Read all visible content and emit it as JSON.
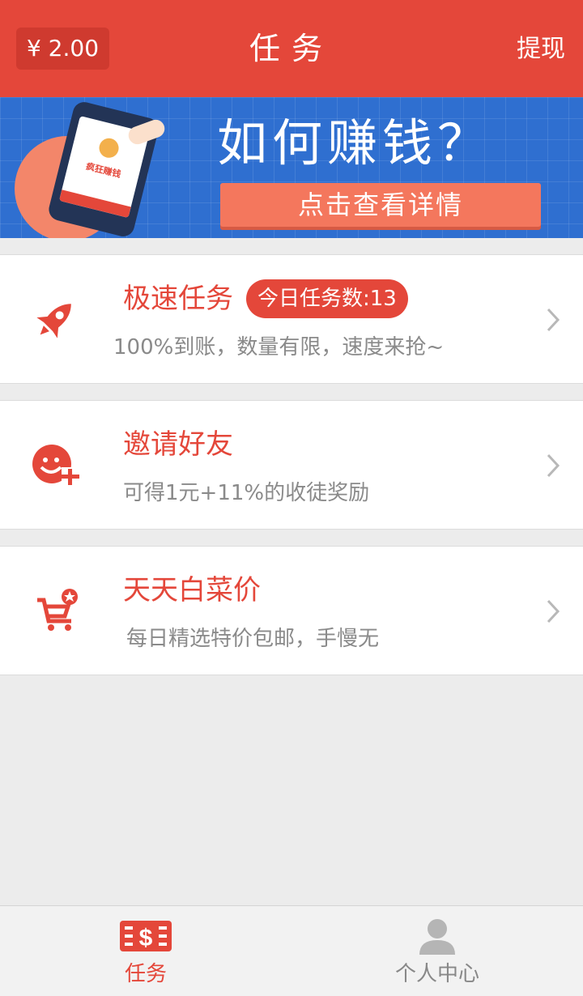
{
  "header": {
    "balance": "¥ 2.00",
    "title": "任务",
    "withdraw_label": "提现"
  },
  "banner": {
    "phone_text": "疯狂赚钱",
    "headline": "如何赚钱？",
    "button_label": "点击查看详情"
  },
  "tasks": [
    {
      "title": "极速任务",
      "badge": "今日任务数:13",
      "subtitle": "100%到账，数量有限，速度来抢~",
      "icon": "rocket-icon"
    },
    {
      "title": "邀请好友",
      "subtitle": "可得1元+11%的收徒奖励",
      "icon": "invite-friend-icon"
    },
    {
      "title": "天天白菜价",
      "subtitle": "每日精选特价包邮，手慢无",
      "icon": "shopping-cart-icon"
    }
  ],
  "tabbar": {
    "items": [
      {
        "label": "任务",
        "icon": "task-dollar-icon",
        "active": true
      },
      {
        "label": "个人中心",
        "icon": "person-icon",
        "active": false
      }
    ]
  },
  "colors": {
    "accent": "#e4473a",
    "banner_bg": "#2f6fd0",
    "banner_button": "#f4775d",
    "subtitle_gray": "#8a8a8a",
    "inactive_tab": "#888888",
    "background": "#ececec"
  }
}
